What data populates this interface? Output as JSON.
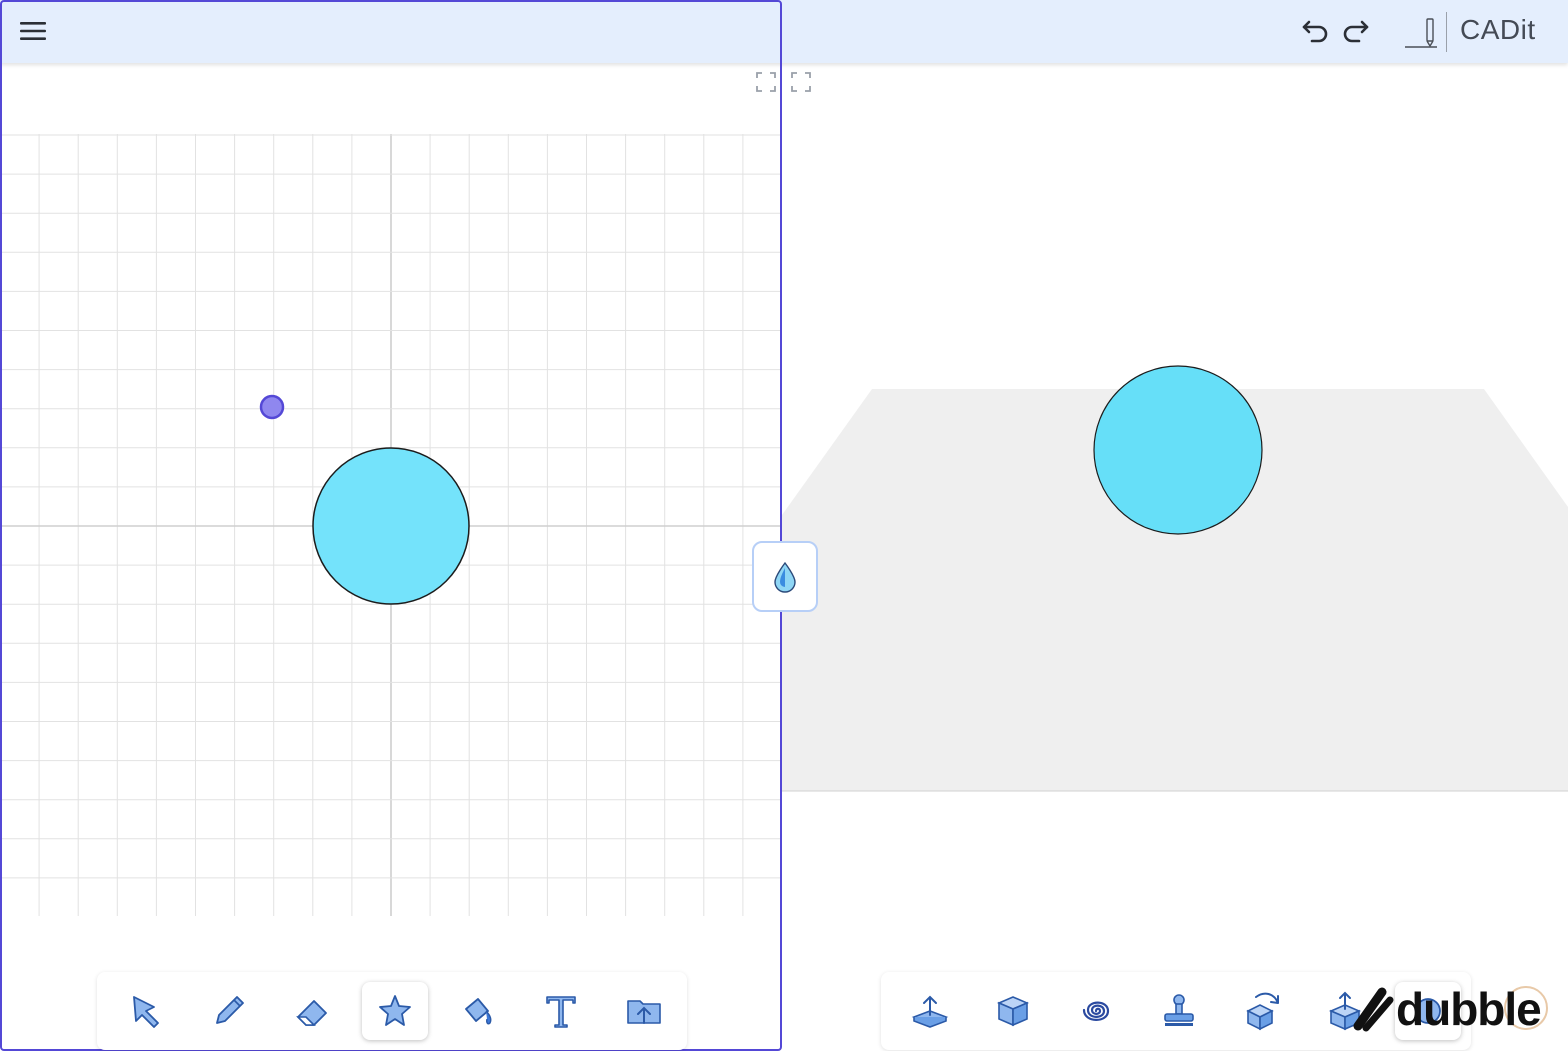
{
  "app": {
    "brand_name": "CADit"
  },
  "colors": {
    "accent": "#5448d6",
    "topbar": "#e4eefd",
    "shape_fill": "#74e3fb",
    "shape_3d_fill": "#66dff8",
    "ground_plane": "#efefef",
    "icon_blue": "#3c78d8"
  },
  "header": {
    "menu_icon": "hamburger-menu-icon",
    "undo_icon": "undo-icon",
    "redo_icon": "redo-icon",
    "draw_mode_icon": "pencil-baseline-icon"
  },
  "sketch_panel": {
    "expand_icons": [
      "expand-corners-icon",
      "expand-corners-icon"
    ],
    "point_handle": "control-point",
    "shape": "circle"
  },
  "viewport_3d": {
    "shape": "circle",
    "splitter_icon": "water-drop-icon"
  },
  "sketch_toolbar": {
    "tools": [
      {
        "name": "select",
        "icon": "cursor-arrow-icon"
      },
      {
        "name": "pencil",
        "icon": "pencil-icon"
      },
      {
        "name": "eraser",
        "icon": "eraser-icon"
      },
      {
        "name": "shapes",
        "icon": "star-icon",
        "active": true
      },
      {
        "name": "fill",
        "icon": "paint-bucket-icon"
      },
      {
        "name": "text",
        "icon": "text-icon"
      },
      {
        "name": "import",
        "icon": "folder-upload-icon"
      }
    ]
  },
  "model_toolbar": {
    "tools": [
      {
        "name": "extrude",
        "icon": "extrude-icon"
      },
      {
        "name": "box",
        "icon": "cube-icon"
      },
      {
        "name": "spiral",
        "icon": "spiral-icon"
      },
      {
        "name": "stamp",
        "icon": "stamp-icon"
      },
      {
        "name": "rotate",
        "icon": "rotate-cube-icon"
      },
      {
        "name": "move",
        "icon": "move-box-icon"
      },
      {
        "name": "more",
        "icon": "circle-icon"
      }
    ]
  },
  "watermark": {
    "text": "dubble"
  }
}
